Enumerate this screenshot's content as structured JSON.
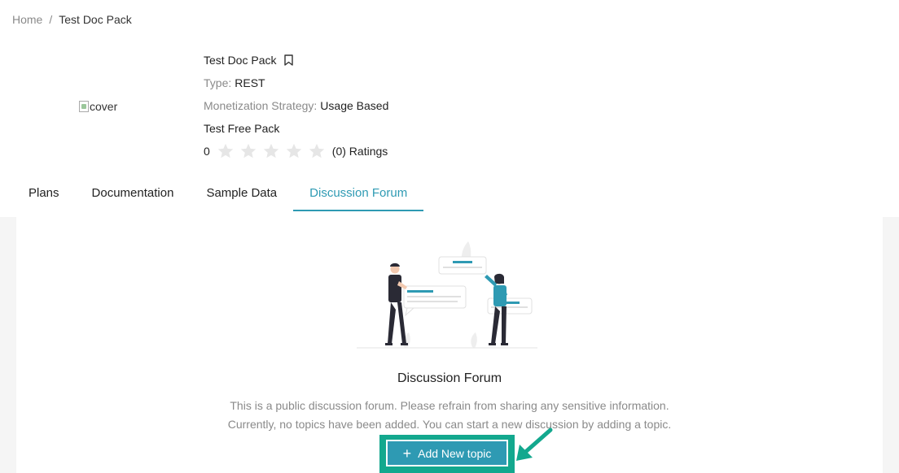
{
  "breadcrumb": {
    "home": "Home",
    "separator": "/",
    "current": "Test Doc Pack"
  },
  "product": {
    "cover_alt": "cover",
    "title": "Test Doc Pack",
    "type_key": "Type:",
    "type_value": "REST",
    "monetization_key": "Monetization Strategy:",
    "monetization_value": "Usage Based",
    "plan_name": "Test Free Pack",
    "rating_value": "0",
    "rating_stars": 0,
    "ratings_label": "(0) Ratings"
  },
  "tabs": [
    {
      "label": "Plans"
    },
    {
      "label": "Documentation"
    },
    {
      "label": "Sample Data"
    },
    {
      "label": "Discussion Forum",
      "active": true
    }
  ],
  "forum": {
    "title": "Discussion Forum",
    "description_line1": "This is a public discussion forum. Please refrain from sharing any sensitive information.",
    "description_line2": "Currently, no topics have been added. You can start a new discussion by adding a topic.",
    "add_button": "Add New topic"
  },
  "colors": {
    "accent": "#2e9ab3",
    "highlight": "#13a88e",
    "muted_text": "#8a8a8a",
    "star_empty": "#e6e6e6"
  },
  "icons": {
    "bookmark": "bookmark-icon",
    "star": "star-icon",
    "plus": "plus-icon",
    "arrow": "arrow-icon"
  }
}
